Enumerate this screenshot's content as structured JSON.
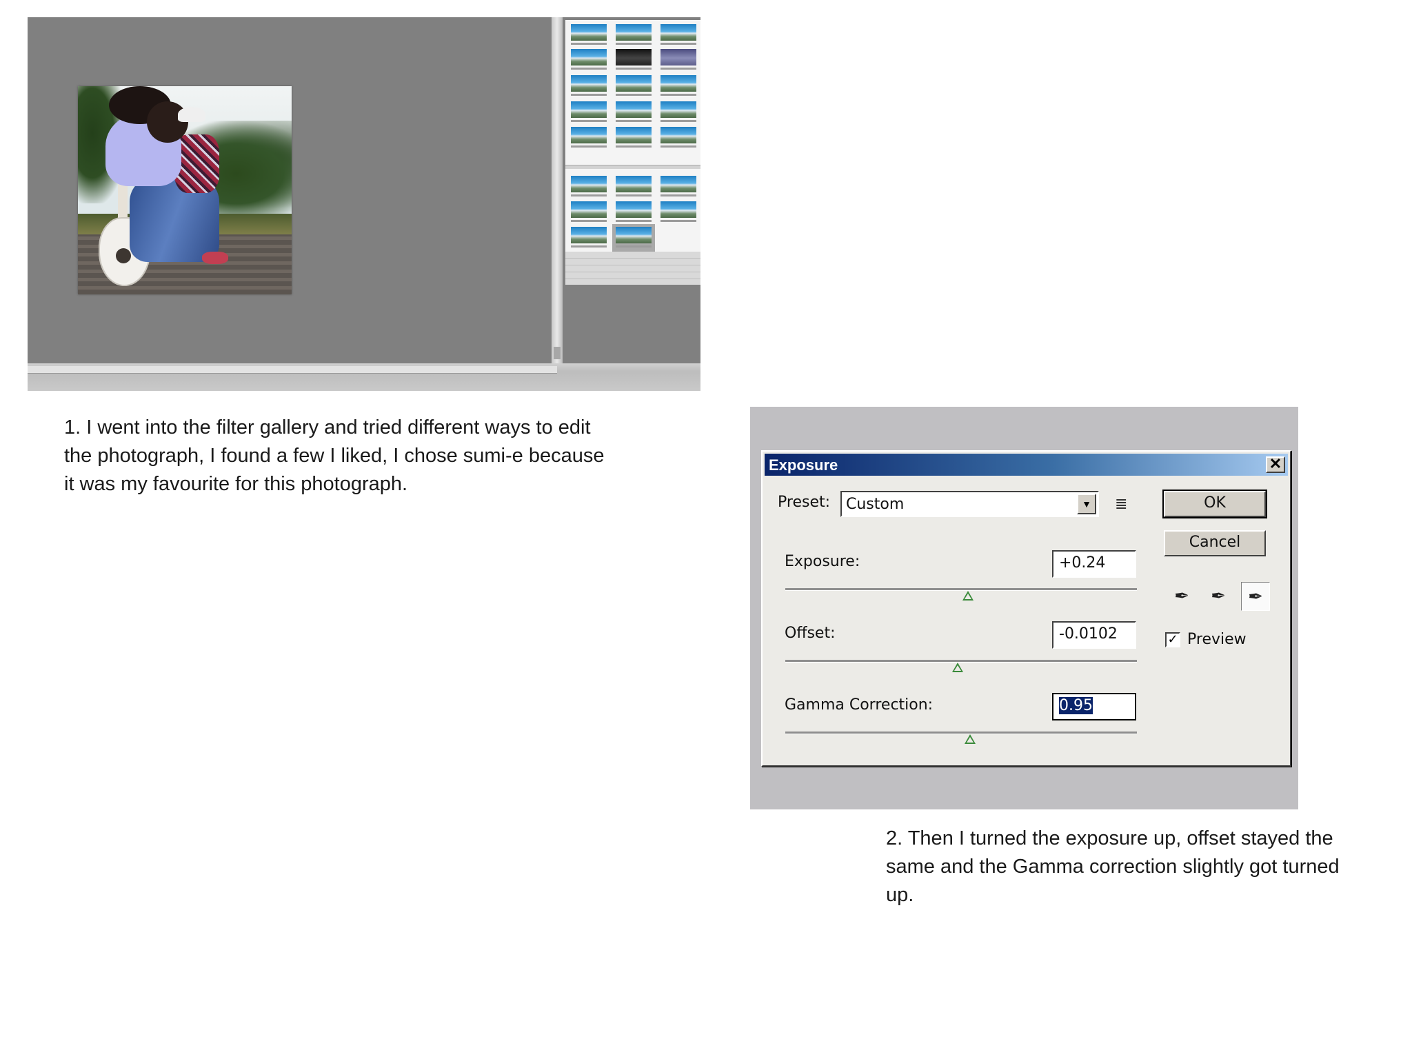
{
  "gallery": {
    "description_icon": "photo-canvas"
  },
  "caption_1": "1. I went into the filter gallery and tried different ways to edit the photograph, I found a few I liked, I chose sumi-e because it was my favourite for this photograph.",
  "caption_2": "2. Then I turned the exposure up, offset stayed the same and the Gamma correction slightly got turned up.",
  "dialog": {
    "title": "Exposure",
    "close_glyph": "✕",
    "preset_label": "Preset:",
    "preset_value": "Custom",
    "preset_arrow": "▼",
    "preset_menu_icon": "≣",
    "ok_label": "OK",
    "cancel_label": "Cancel",
    "preview_label": "Preview",
    "preview_checked": true,
    "preview_check_glyph": "✓",
    "exposure_label": "Exposure:",
    "exposure_value": "+0.24",
    "offset_label": "Offset:",
    "offset_value": "-0.0102",
    "gamma_label": "Gamma Correction:",
    "gamma_value": "0.95",
    "sliders": {
      "exposure_fraction": 0.52,
      "offset_fraction": 0.49,
      "gamma_fraction": 0.525
    },
    "eyedropper_glyph": "✒"
  }
}
